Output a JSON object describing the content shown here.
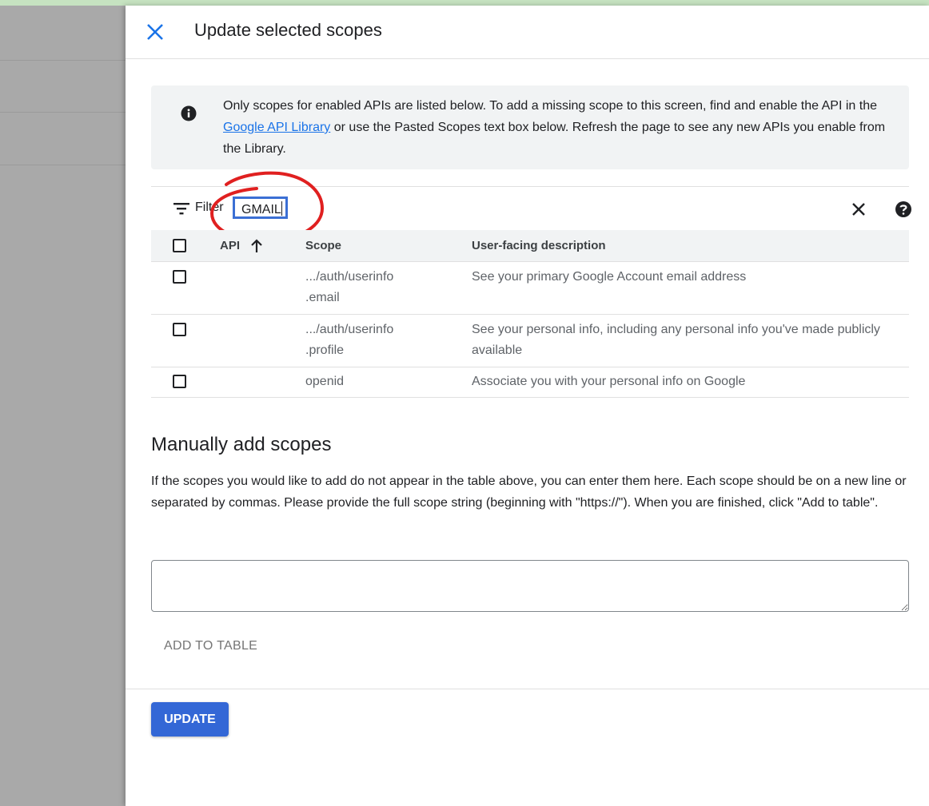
{
  "dialog": {
    "title": "Update selected scopes"
  },
  "info": {
    "text_before_link": "Only scopes for enabled APIs are listed below. To add a missing scope to this screen, find and enable the API in the ",
    "link_label": "Google API Library",
    "text_after_link": " or use the Pasted Scopes text box below. Refresh the page to see any new APIs you enable from the Library."
  },
  "filter": {
    "label": "Filter",
    "value": "GMAIL"
  },
  "table": {
    "headers": {
      "api": "API",
      "scope": "Scope",
      "description": "User-facing description"
    },
    "sort": "ascending",
    "rows": [
      {
        "scope": ".../auth/userinfo .email",
        "description": "See your primary Google Account email address"
      },
      {
        "scope": ".../auth/userinfo .profile",
        "description": "See your personal info, including any personal info you've made publicly available"
      },
      {
        "scope": "openid",
        "description": "Associate you with your personal info on Google"
      }
    ]
  },
  "manual": {
    "title": "Manually add scopes",
    "text": "If the scopes you would like to add do not appear in the table above, you can enter them here. Each scope should be on a new line or separated by commas. Please provide the full scope string (beginning with \"https://\"). When you are finished, click \"Add to table\".",
    "input_value": "",
    "add_button": "ADD TO TABLE"
  },
  "footer": {
    "update_button": "UPDATE"
  },
  "colors": {
    "accent": "#3367d6",
    "link": "#1a73e8",
    "annotation": "#e02020"
  },
  "icons": [
    "close-icon",
    "info-icon",
    "filter-icon",
    "clear-filter-icon",
    "help-icon",
    "sort-arrow-up-icon"
  ]
}
